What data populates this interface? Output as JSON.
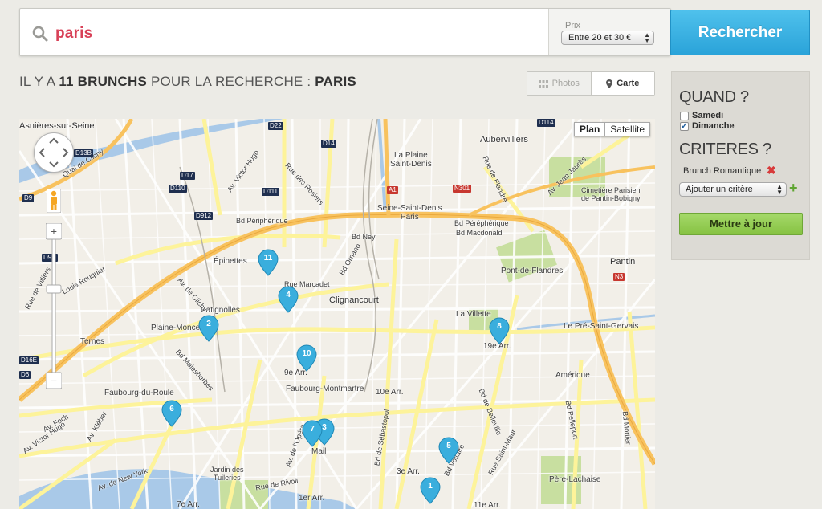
{
  "search": {
    "query": "paris",
    "price_label": "Prix",
    "price_value": "Entre 20 et 30 €",
    "submit_label": "Rechercher"
  },
  "results": {
    "prefix": "Il y a",
    "count_label": "11 brunchs",
    "middle": "pour la recherche :",
    "term": "Paris"
  },
  "view_toggle": {
    "photos_label": "Photos",
    "carte_label": "Carte",
    "active": "Carte"
  },
  "map": {
    "type_options": [
      "Plan",
      "Satellite"
    ],
    "active_type": "Plan",
    "places": [
      "Asnières-sur-Seine",
      "Aubervilliers",
      "La Plaine\nSaint-Denis",
      "Seine-Saint-Denis\nParis",
      "Cimetière Parisien\nde Pantin-Bobigny",
      "Pantin",
      "Pont-de-Flandres",
      "La Villette",
      "Le Pré-Saint-Gervais",
      "19e Arr.",
      "Amérique",
      "Clignancourt",
      "Épinettes",
      "Batignolles",
      "Plaine-Monceau",
      "Ternes",
      "9e Arr.",
      "Faubourg-Montmartre",
      "10e Arr.",
      "Faubourg-du-Roule",
      "Mail",
      "3e Arr.",
      "1er Arr.",
      "7e Arr.",
      "11e Arr.",
      "Père-Lachaise",
      "Jardin des\nTuileries"
    ],
    "roads": [
      "Bd Périphérique",
      "Bd Ney",
      "Bd Macdonald",
      "Bd Péréphérique",
      "Rue Marcadet",
      "Av. de Clichy",
      "Bd Malesherbes",
      "Av. Foch",
      "Av. Kléber",
      "Av. Victor Hugo",
      "Bd de Belleville",
      "Bd Voltaire",
      "Bd de Sébastopol",
      "Bd Mortier",
      "Av. Jean Jaurès",
      "Rue de Flandre",
      "Quai de Clichy",
      "Rue de Villiers",
      "Louis Rouquier",
      "Av. Victor Hugo",
      "Rue des Rosiers",
      "Bd Ornano",
      "Av. de l'Opéra",
      "Av. de New York",
      "Rue de Rivoli",
      "Rue Saint-Maur",
      "Bd Pelleport"
    ],
    "road_shields": [
      "D22",
      "D14",
      "D114",
      "D17",
      "D110",
      "D111",
      "D912",
      "D9",
      "D13B",
      "A1",
      "N301",
      "N3",
      "D9B",
      "D16E",
      "D6"
    ],
    "markers": [
      "11",
      "4",
      "2",
      "10",
      "8",
      "6",
      "7",
      "3",
      "5",
      "1"
    ],
    "colors": {
      "land": "#f2efe8",
      "street": "#ffffff",
      "major_road": "#fdf39a",
      "highway": "#f8c25e",
      "water": "#a9c9e8",
      "park": "#c8dfa0",
      "marker": "#3aaedd"
    }
  },
  "filters": {
    "quand_title": "QUAND ?",
    "days": [
      {
        "label": "Samedi",
        "checked": false
      },
      {
        "label": "Dimanche",
        "checked": true
      }
    ],
    "criteres_title": "CRITERES ?",
    "criteria": [
      "Brunch Romantique"
    ],
    "add_criterion_placeholder": "Ajouter un critère",
    "update_label": "Mettre à jour"
  }
}
